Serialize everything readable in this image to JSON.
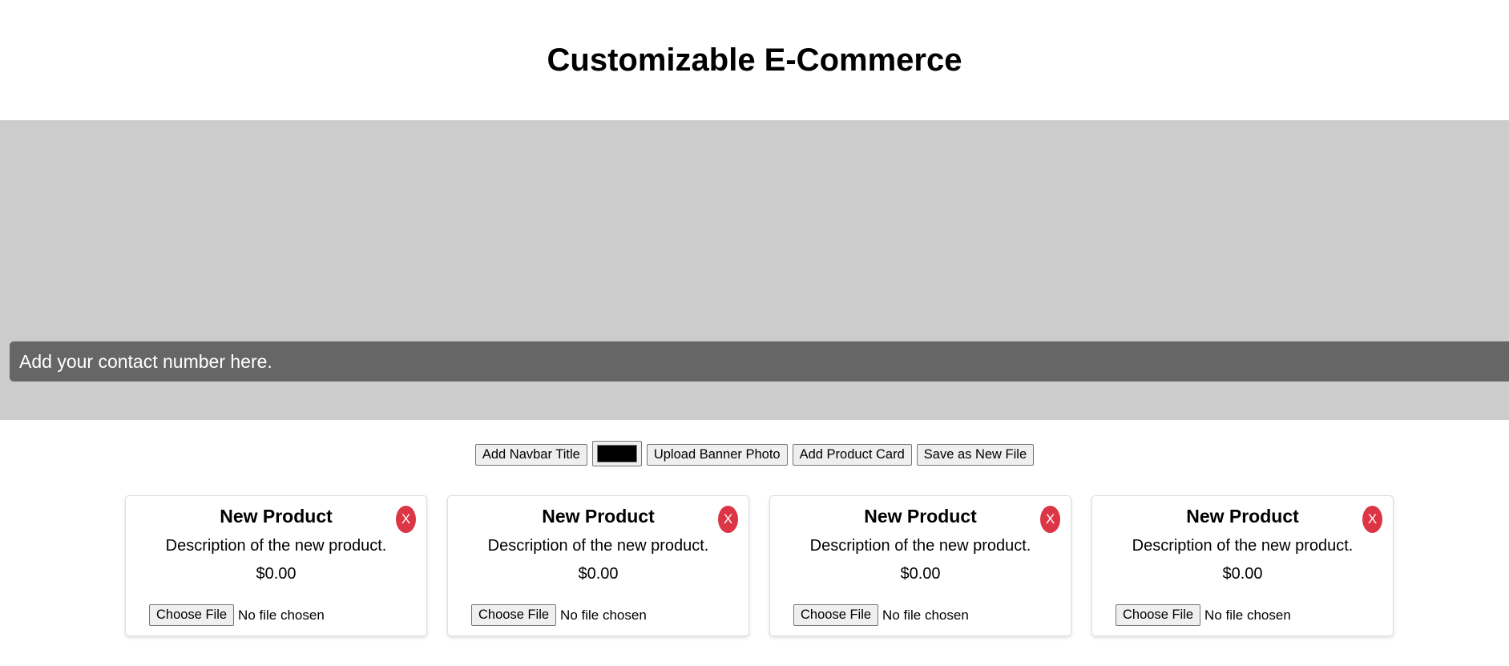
{
  "header": {
    "title": "Customizable E-Commerce"
  },
  "banner": {
    "contact_text": "Add your contact number here.",
    "background_color": "#cccccc",
    "contact_bar_color": "#666666"
  },
  "toolbar": {
    "add_navbar_title_label": "Add Navbar Title",
    "color_value": "#000000",
    "upload_banner_label": "Upload Banner Photo",
    "add_product_card_label": "Add Product Card",
    "save_new_file_label": "Save as New File"
  },
  "products": [
    {
      "title": "New Product",
      "description": "Description of the new product.",
      "price": "$0.00",
      "remove_label": "X",
      "choose_file_label": "Choose File",
      "file_status": "No file chosen"
    },
    {
      "title": "New Product",
      "description": "Description of the new product.",
      "price": "$0.00",
      "remove_label": "X",
      "choose_file_label": "Choose File",
      "file_status": "No file chosen"
    },
    {
      "title": "New Product",
      "description": "Description of the new product.",
      "price": "$0.00",
      "remove_label": "X",
      "choose_file_label": "Choose File",
      "file_status": "No file chosen"
    },
    {
      "title": "New Product",
      "description": "Description of the new product.",
      "price": "$0.00",
      "remove_label": "X",
      "choose_file_label": "Choose File",
      "file_status": "No file chosen"
    }
  ],
  "colors": {
    "remove_button": "#dc3545"
  }
}
